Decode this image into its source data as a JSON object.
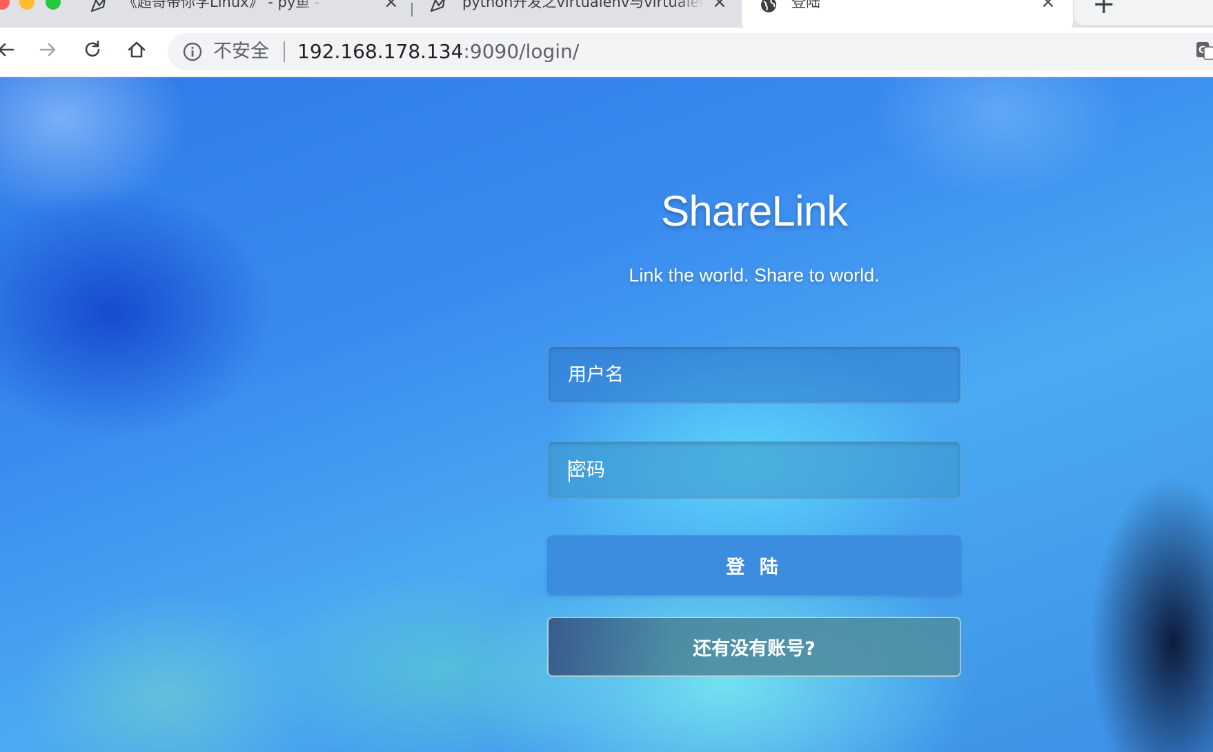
{
  "browser": {
    "tabs": [
      {
        "title": "《超哥带你学Linux》 - py鱼 - 博",
        "favicon": "pen-bird-icon",
        "active": false
      },
      {
        "title": "python开发之virtualenv与virtualenvwrapper",
        "favicon": "pen-bird-icon",
        "active": false
      },
      {
        "title": "登陆",
        "favicon": "globe-icon",
        "active": true
      }
    ],
    "new_tab_label": "+",
    "security_label": "不安全",
    "url_host": "192.168.178.134",
    "url_path": ":9090/login/"
  },
  "login": {
    "brand": "ShareLink",
    "tagline": "Link the world. Share to world.",
    "username_placeholder": "用户名",
    "password_placeholder": "密码",
    "login_button": "登 陆",
    "register_button": "还有没有账号?"
  },
  "colors": {
    "login_button": "#3c8de0",
    "text": "#ffffff",
    "background": "#3b8cef"
  }
}
